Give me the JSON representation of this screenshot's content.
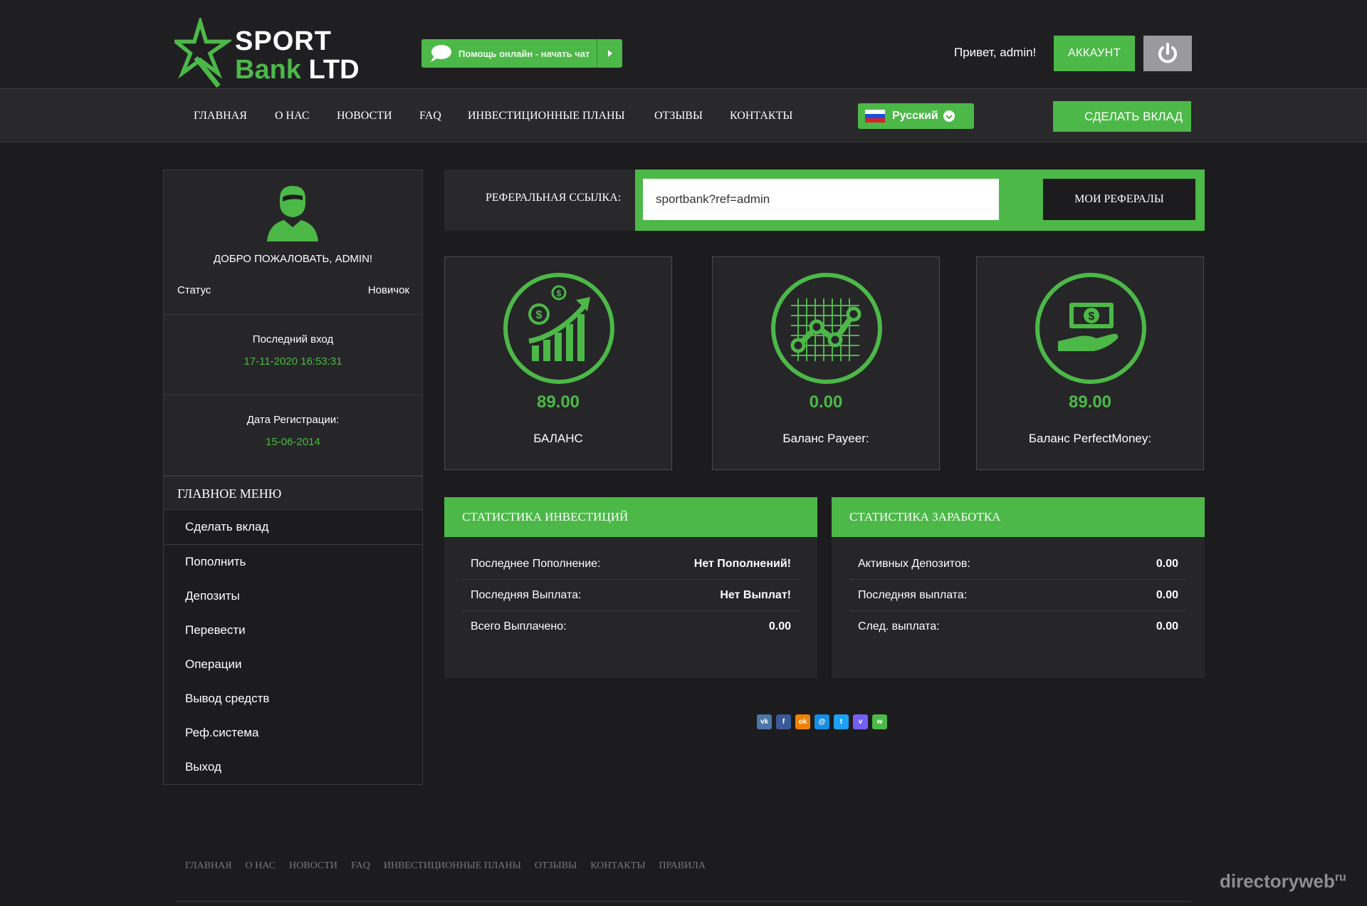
{
  "header": {
    "logo_line1": "SPORT",
    "logo_line2_a": "Bank",
    "logo_line2_b": "LTD",
    "chat_label": "Помощь онлайн - начать чат",
    "greeting": "Привет, admin!",
    "account_label": "АККАУНТ"
  },
  "nav": {
    "items": [
      "ГЛАВНАЯ",
      "О НАС",
      "НОВОСТИ",
      "FAQ",
      "ИНВЕСТИЦИОННЫЕ ПЛАНЫ",
      "ОТЗЫВЫ",
      "КОНТАКТЫ"
    ],
    "language": "Русский",
    "deposit_label": "СДЕЛАТЬ ВКЛАД"
  },
  "profile": {
    "welcome": "ДОБРО ПОЖАЛОВАТЬ, ADMIN!",
    "status_label": "Статус",
    "status_value": "Новичок",
    "last_login_label": "Последний вход",
    "last_login_value": "17-11-2020 16:53:31",
    "reg_label": "Дата Регистрации:",
    "reg_value": "15-06-2014"
  },
  "menu": {
    "title": "ГЛАВНОЕ МЕНЮ",
    "items": [
      "Сделать вклад",
      "Пополнить",
      "Депозиты",
      "Перевести",
      "Операции",
      "Вывод средств",
      "Реф.система",
      "Выход"
    ]
  },
  "referral": {
    "label": "РЕФЕРАЛЬНАЯ ССЫЛКА:",
    "value": "sportbank?ref=admin",
    "button": "МОИ РЕФЕРАЛЫ"
  },
  "balances": [
    {
      "amount": "89.00",
      "name": "БАЛАНС",
      "icon": "growth-chart-icon"
    },
    {
      "amount": "0.00",
      "name": "Баланс Payeer:",
      "icon": "line-graph-icon"
    },
    {
      "amount": "89.00",
      "name": "Баланс PerfectMoney:",
      "icon": "money-hand-icon"
    }
  ],
  "invest_stats": {
    "title": "СТАТИСТИКА ИНВЕСТИЦИЙ",
    "rows": [
      {
        "label": "Последнее Пополнение:",
        "value": "Нет Пополнений!"
      },
      {
        "label": "Последняя Выплата:",
        "value": "Нет Выплат!"
      },
      {
        "label": "Всего Выплачено:",
        "value": "0.00"
      }
    ]
  },
  "earn_stats": {
    "title": "СТАТИСТИКА ЗАРАБОТКА",
    "rows": [
      {
        "label": "Активных Депозитов:",
        "value": "0.00"
      },
      {
        "label": "Последняя выплата:",
        "value": "0.00"
      },
      {
        "label": "След. выплата:",
        "value": "0.00"
      }
    ]
  },
  "social": [
    {
      "name": "vk-icon",
      "glyph": "vk",
      "color": "#4a76a8"
    },
    {
      "name": "facebook-icon",
      "glyph": "f",
      "color": "#3b5998"
    },
    {
      "name": "odnoklassniki-icon",
      "glyph": "ok",
      "color": "#ee8208"
    },
    {
      "name": "mail-ru-icon",
      "glyph": "@",
      "color": "#168de2"
    },
    {
      "name": "twitter-icon",
      "glyph": "t",
      "color": "#1da1f2"
    },
    {
      "name": "viber-icon",
      "glyph": "v",
      "color": "#7360f2"
    },
    {
      "name": "whatsapp-icon",
      "glyph": "w",
      "color": "#4cb848"
    }
  ],
  "footer": {
    "items": [
      "ГЛАВНАЯ",
      "О НАС",
      "НОВОСТИ",
      "FAQ",
      "ИНВЕСТИЦИОННЫЕ ПЛАНЫ",
      "ОТЗЫВЫ",
      "КОНТАКТЫ",
      "ПРАВИЛА"
    ]
  },
  "watermark": {
    "main": "directoryweb",
    "sup": "ru"
  },
  "colors": {
    "accent": "#4cb848",
    "background": "#1c1c1e",
    "panel": "#262628"
  }
}
